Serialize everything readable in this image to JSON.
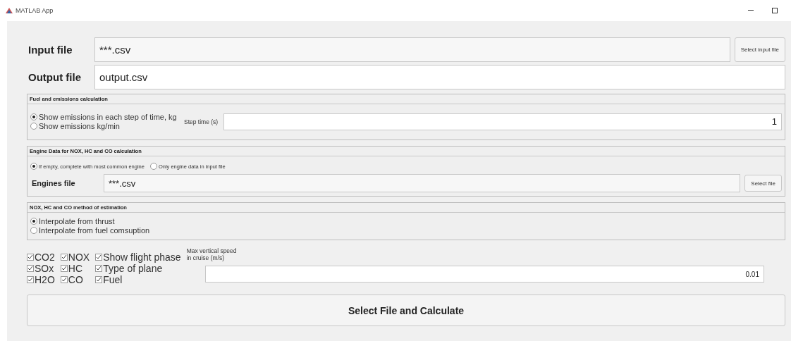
{
  "window": {
    "title": "MATLAB App"
  },
  "input_file": {
    "label": "Input file",
    "value": "***.csv",
    "button": "Select input file"
  },
  "output_file": {
    "label": "Output file",
    "value": "output.csv"
  },
  "fuel_panel": {
    "title": "Fuel and emissions calculation",
    "options": [
      {
        "label": "Show emissions in each step of time, kg",
        "selected": true
      },
      {
        "label": "Show emissions kg/min",
        "selected": false
      }
    ],
    "step_time": {
      "label": "Step time (s)",
      "value": "1"
    }
  },
  "engine_panel": {
    "title": "Engine Data for NOX, HC and CO calculation",
    "options": [
      {
        "label": "If empty, complete with most common engine",
        "selected": true
      },
      {
        "label": "Only engine data in input file",
        "selected": false
      }
    ],
    "engines_file": {
      "label": "Engines file",
      "value": "***.csv",
      "button": "Select file"
    }
  },
  "method_panel": {
    "title": "NOX, HC and CO method of estimation",
    "options": [
      {
        "label": "Interpolate from thrust",
        "selected": true
      },
      {
        "label": "Interpolate from fuel comsuption",
        "selected": false
      }
    ]
  },
  "checkbox_columns": [
    [
      {
        "label": "CO2",
        "checked": true
      },
      {
        "label": "SOx",
        "checked": true
      },
      {
        "label": "H2O",
        "checked": true
      }
    ],
    [
      {
        "label": "NOX",
        "checked": true
      },
      {
        "label": "HC",
        "checked": true
      },
      {
        "label": "CO",
        "checked": true
      }
    ],
    [
      {
        "label": "Show flight phase",
        "checked": true
      },
      {
        "label": "Type of plane",
        "checked": true
      },
      {
        "label": "Fuel",
        "checked": true
      }
    ]
  ],
  "max_vertical_speed": {
    "label_lines": [
      "Max vertical speed",
      "in cruise (m/s)"
    ],
    "value": "0.01"
  },
  "calculate_button": "Select File and Calculate"
}
